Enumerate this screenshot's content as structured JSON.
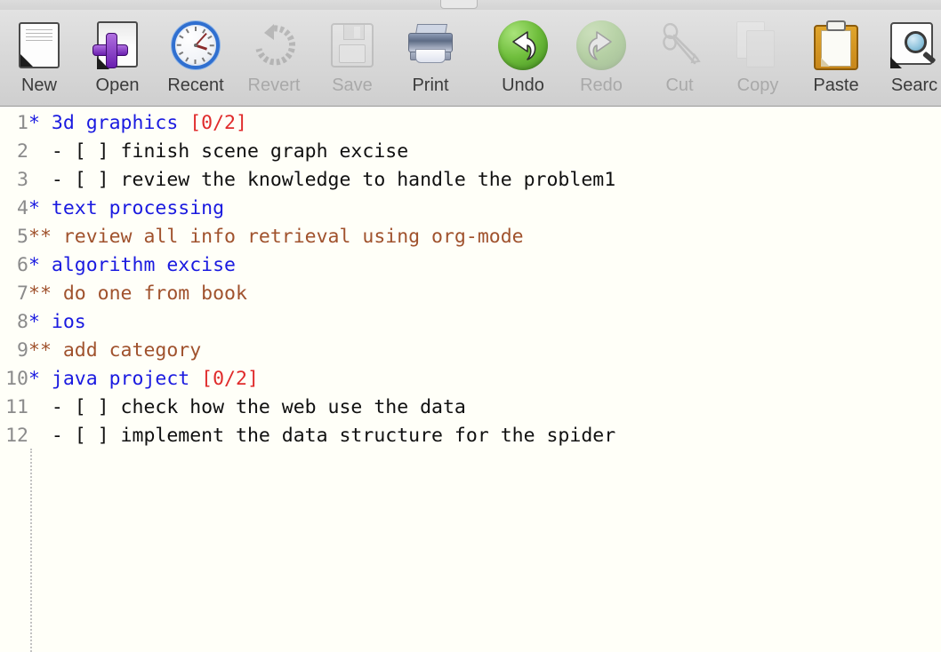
{
  "window": {
    "title_strip_nub": "tab-nub"
  },
  "toolbar": {
    "items": [
      {
        "label": "New",
        "icon": "new-document-icon",
        "disabled": false
      },
      {
        "label": "Open",
        "icon": "open-document-icon",
        "disabled": false
      },
      {
        "label": "Recent",
        "icon": "clock-icon",
        "disabled": false
      },
      {
        "label": "Revert",
        "icon": "revert-arrow-icon",
        "disabled": true
      },
      {
        "label": "Save",
        "icon": "floppy-disk-icon",
        "disabled": true
      },
      {
        "label": "Print",
        "icon": "printer-icon",
        "disabled": false
      },
      {
        "label": "Undo",
        "icon": "undo-arrow-icon",
        "disabled": false
      },
      {
        "label": "Redo",
        "icon": "redo-arrow-icon",
        "disabled": true
      },
      {
        "label": "Cut",
        "icon": "scissors-icon",
        "disabled": true
      },
      {
        "label": "Copy",
        "icon": "copy-pages-icon",
        "disabled": true
      },
      {
        "label": "Paste",
        "icon": "clipboard-icon",
        "disabled": false
      },
      {
        "label": "Searc",
        "icon": "search-icon",
        "disabled": false
      }
    ]
  },
  "colors": {
    "heading_level1": "#1a1ae0",
    "heading_level2": "#a0522d",
    "statistics_cookie": "#e02b2b",
    "body_text": "#101010",
    "line_number": "#8b8b8b",
    "editor_background": "#fffff8",
    "toolbar_background": "#d9d9d9"
  },
  "editor": {
    "lines": [
      {
        "num": "1",
        "segments": [
          {
            "text": "* 3d graphics ",
            "style": "h1"
          },
          {
            "text": "[0/2]",
            "style": "cookie"
          }
        ]
      },
      {
        "num": "2",
        "segments": [
          {
            "text": "  - [ ] finish scene graph excise",
            "style": "body-txt"
          }
        ]
      },
      {
        "num": "3",
        "segments": [
          {
            "text": "  - [ ] review the knowledge to handle the problem1",
            "style": "body-txt"
          }
        ]
      },
      {
        "num": "4",
        "segments": [
          {
            "text": "* text processing",
            "style": "h1"
          }
        ]
      },
      {
        "num": "5",
        "segments": [
          {
            "text": "** review all info retrieval using org-mode",
            "style": "h2"
          }
        ]
      },
      {
        "num": "6",
        "segments": [
          {
            "text": "* algorithm excise",
            "style": "h1"
          }
        ]
      },
      {
        "num": "7",
        "segments": [
          {
            "text": "** do one from book",
            "style": "h2"
          }
        ]
      },
      {
        "num": "8",
        "segments": [
          {
            "text": "* ios",
            "style": "h1"
          }
        ]
      },
      {
        "num": "9",
        "segments": [
          {
            "text": "** add category",
            "style": "h2"
          }
        ]
      },
      {
        "num": "10",
        "segments": [
          {
            "text": "* java project ",
            "style": "h1"
          },
          {
            "text": "[0/2]",
            "style": "cookie"
          }
        ]
      },
      {
        "num": "11",
        "segments": [
          {
            "text": "  - [ ] check how the web use the data",
            "style": "body-txt"
          }
        ]
      },
      {
        "num": "12",
        "segments": [
          {
            "text": "  - [ ] implement the data structure for the spider",
            "style": "body-txt"
          }
        ]
      }
    ]
  }
}
